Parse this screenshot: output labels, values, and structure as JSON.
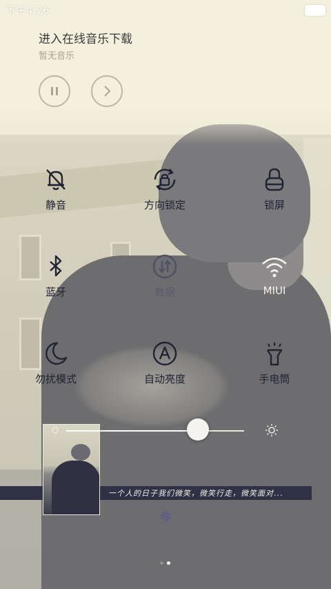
{
  "status_bar": {
    "time": "下午4:26"
  },
  "music": {
    "title": "进入在线音乐下载",
    "subtitle": "暂无音乐",
    "pause_icon": "pause-icon",
    "next_icon": "chevron-right-icon"
  },
  "toggles": [
    {
      "label": "静音",
      "icon": "bell-off-icon"
    },
    {
      "label": "方向锁定",
      "icon": "rotation-lock-icon"
    },
    {
      "label": "锁屏",
      "icon": "lock-icon"
    },
    {
      "label": "蓝牙",
      "icon": "bluetooth-icon"
    },
    {
      "label": "数据",
      "icon": "data-icon"
    },
    {
      "label": "MIUI",
      "icon": "wifi-icon"
    },
    {
      "label": "勿扰模式",
      "icon": "moon-icon"
    },
    {
      "label": "自动亮度",
      "icon": "auto-brightness-icon"
    },
    {
      "label": "手电筒",
      "icon": "flashlight-icon"
    }
  ],
  "brightness": {
    "level": 0.74
  },
  "lyrics": {
    "text": "一个人的日子我们微笑，微笑行走，微笑面对..."
  },
  "pager": {
    "count": 2,
    "active": 1
  },
  "colors": {
    "icon_dark": "#1f2333",
    "icon_dim": "#4e5063",
    "accent_gear": "#5a5f8c",
    "lyric_bg": "#2f3247"
  }
}
